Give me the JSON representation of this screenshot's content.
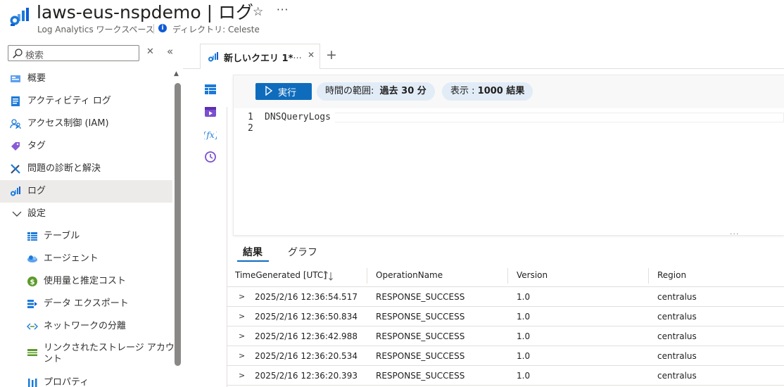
{
  "header": {
    "title": "laws-eus-nspdemo | ログ",
    "subtitle": "Log Analytics ワークスペース",
    "directory": "ディレクトリ: Celeste",
    "star_glyph": "☆",
    "more_glyph": "···"
  },
  "sidebar": {
    "search_placeholder": "検索",
    "clear_glyph": "✕",
    "collapse_glyph": "«",
    "items": [
      {
        "label": "概要",
        "icon": "overview-icon"
      },
      {
        "label": "アクティビティ ログ",
        "icon": "activity-log-icon"
      },
      {
        "label": "アクセス制御 (IAM)",
        "icon": "iam-icon"
      },
      {
        "label": "タグ",
        "icon": "tag-icon"
      },
      {
        "label": "問題の診断と解決",
        "icon": "diagnose-icon"
      },
      {
        "label": "ログ",
        "icon": "logs-icon",
        "active": true
      },
      {
        "label": "設定",
        "icon": "chevron-down-icon"
      },
      {
        "label": "テーブル",
        "icon": "table-icon"
      },
      {
        "label": "エージェント",
        "icon": "agents-icon"
      },
      {
        "label": "使用量と推定コスト",
        "icon": "cost-icon"
      },
      {
        "label": "データ エクスポート",
        "icon": "export-icon"
      },
      {
        "label": "ネットワークの分離",
        "icon": "network-icon"
      },
      {
        "label": "リンクされたストレージ アカウ",
        "label2": "ント",
        "icon": "storage-icon"
      },
      {
        "label": "プロパティ",
        "icon": "properties-icon"
      }
    ]
  },
  "query_tab": {
    "label": "新しいクエリ 1*",
    "more_glyph": "···",
    "close_glyph": "✕",
    "add_glyph": "+"
  },
  "toolbar": {
    "run_label": "実行",
    "time_range_label": "時間の範囲:",
    "time_range_value": "過去 30 分",
    "show_label": "表示 :",
    "show_value": "1000 結果"
  },
  "editor": {
    "line_numbers": [
      "1",
      "2"
    ],
    "code": "DNSQueryLogs"
  },
  "results": {
    "tabs": [
      "結果",
      "グラフ"
    ],
    "splitter_glyph": "···",
    "columns": [
      "TimeGenerated [UTC]",
      "OperationName",
      "Version",
      "Region"
    ],
    "rows": [
      [
        "2025/2/16 12:36:54.517",
        "RESPONSE_SUCCESS",
        "1.0",
        "centralus"
      ],
      [
        "2025/2/16 12:36:50.834",
        "RESPONSE_SUCCESS",
        "1.0",
        "centralus"
      ],
      [
        "2025/2/16 12:36:42.988",
        "RESPONSE_SUCCESS",
        "1.0",
        "centralus"
      ],
      [
        "2025/2/16 12:36:20.534",
        "RESPONSE_SUCCESS",
        "1.0",
        "centralus"
      ],
      [
        "2025/2/16 12:36:20.393",
        "RESPONSE_SUCCESS",
        "1.0",
        "centralus"
      ]
    ]
  },
  "colors": {
    "accent": "#0f6cbd",
    "pill_bg": "#e1ecf7",
    "active_nav": "#edebe9"
  }
}
